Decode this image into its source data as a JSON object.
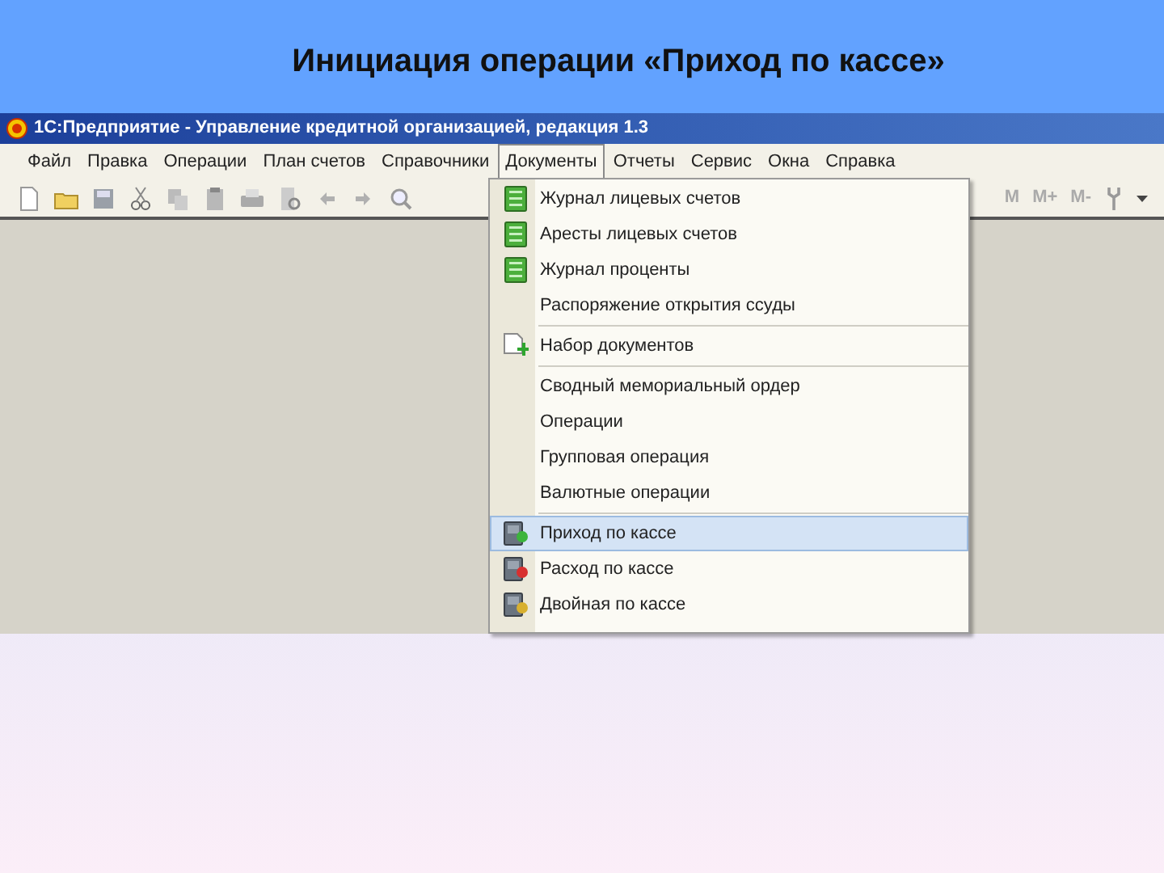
{
  "slide_title": "Инициация операции «Приход по кассе»",
  "window": {
    "title": "1С:Предприятие - Управление кредитной организацией, редакция 1.3"
  },
  "menu_bar": [
    {
      "label": "Файл",
      "selected": false
    },
    {
      "label": "Правка",
      "selected": false
    },
    {
      "label": "Операции",
      "selected": false
    },
    {
      "label": "План счетов",
      "selected": false
    },
    {
      "label": "Справочники",
      "selected": false
    },
    {
      "label": "Документы",
      "selected": true
    },
    {
      "label": "Отчеты",
      "selected": false
    },
    {
      "label": "Сервис",
      "selected": false
    },
    {
      "label": "Окна",
      "selected": false
    },
    {
      "label": "Справка",
      "selected": false
    }
  ],
  "toolbar": {
    "memory_buttons": [
      "M",
      "M+",
      "M-"
    ]
  },
  "dropdown_groups": [
    [
      {
        "label": "Журнал лицевых счетов",
        "kind": "journal",
        "selected": false
      },
      {
        "label": "Аресты лицевых счетов",
        "kind": "journal",
        "selected": false
      },
      {
        "label": "Журнал проценты",
        "kind": "journal",
        "selected": false
      },
      {
        "label": "Распоряжение открытия ссуды",
        "kind": "plain",
        "selected": false
      }
    ],
    [
      {
        "label": "Набор документов",
        "kind": "add",
        "selected": false
      }
    ],
    [
      {
        "label": "Сводный мемориальный ордер",
        "kind": "plain",
        "selected": false
      },
      {
        "label": "Операции",
        "kind": "plain",
        "selected": false
      },
      {
        "label": "Групповая операция",
        "kind": "plain",
        "selected": false
      },
      {
        "label": "Валютные операции",
        "kind": "plain",
        "selected": false
      }
    ],
    [
      {
        "label": "Приход по кассе",
        "kind": "cash_in",
        "selected": true
      },
      {
        "label": "Расход по кассе",
        "kind": "cash_out",
        "selected": false
      },
      {
        "label": "Двойная по кассе",
        "kind": "cash_double",
        "selected": false
      }
    ]
  ]
}
